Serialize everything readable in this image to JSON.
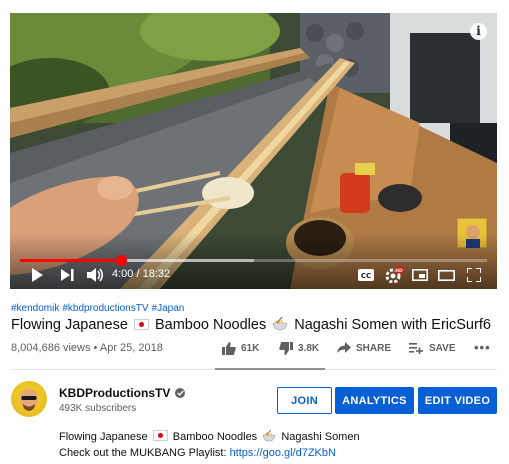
{
  "player": {
    "time_current": "4:00",
    "time_separator": " / ",
    "time_total": "18:32",
    "progress_played_fraction": 0.216,
    "progress_loaded_fraction": 0.5,
    "info_icon_glyph": "i",
    "icons": [
      "play-icon",
      "next-icon",
      "volume-icon",
      "captions-icon",
      "settings-icon",
      "miniplayer-icon",
      "theater-icon",
      "fullscreen-icon",
      "info-icon"
    ],
    "accent_color": "#ff0000"
  },
  "video": {
    "hashtags": [
      "#kendomik",
      "#kbdproductionsTV",
      "#Japan"
    ],
    "title_part1": "Flowing Japanese",
    "title_part2": "Bamboo Noodles",
    "title_part3": "Nagashi Somen with EricSurf6",
    "views": "8,004,686 views",
    "meta_separator": " • ",
    "date": "Apr 25, 2018"
  },
  "actions": {
    "like_count": "61K",
    "dislike_count": "3.8K",
    "share_label": "SHARE",
    "save_label": "SAVE",
    "more_glyph": "•••"
  },
  "channel": {
    "name": "KBDProductionsTV",
    "subscribers": "493K subscribers",
    "join_label": "JOIN",
    "analytics_label": "ANALYTICS",
    "edit_label": "EDIT VIDEO",
    "brand_color": "#065fd4"
  },
  "description": {
    "line1_part1": "Flowing Japanese",
    "line1_part2": "Bamboo Noodles",
    "line1_part3": "Nagashi Somen",
    "line2_text": "Check out the MUKBANG Playlist: ",
    "line2_link": "https://goo.gl/d7ZKbN"
  }
}
